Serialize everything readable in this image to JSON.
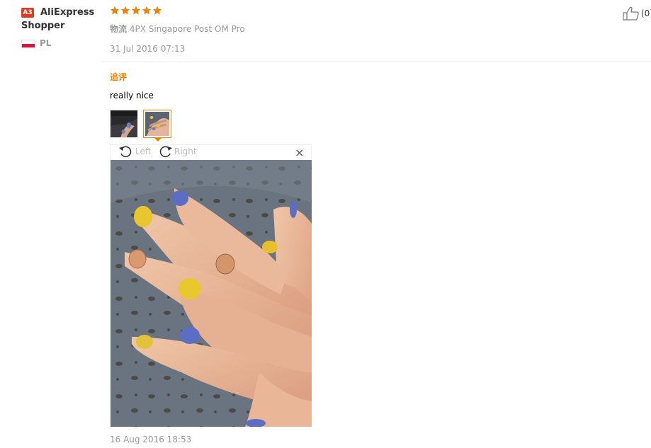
{
  "user": {
    "badge": "A3",
    "name": "AliExpress Shopper",
    "country": "PL"
  },
  "review": {
    "rating": 5,
    "logistics_label": "物流",
    "logistics_value": "4PX Singapore Post OM Pro",
    "date": "31 Jul 2016 07:13",
    "helpful_count": "(0)"
  },
  "followup": {
    "label": "追评",
    "text": "really nice",
    "thumbnails": [
      "thumb-1",
      "thumb-2"
    ],
    "selected_thumbnail": 2,
    "viewer": {
      "rotate_left": "Left",
      "rotate_right": "Right",
      "close": "×"
    },
    "date": "16 Aug 2016 18:53"
  },
  "colors": {
    "accent": "#f08200",
    "badge": "#e4391e",
    "muted": "#999999",
    "star": "#f08200"
  },
  "icons": {
    "star": "star-icon",
    "thumbs_up": "thumbs-up-icon",
    "rotate_left": "rotate-left-icon",
    "rotate_right": "rotate-right-icon",
    "close": "close-icon",
    "flag": "flag-pl-icon"
  }
}
